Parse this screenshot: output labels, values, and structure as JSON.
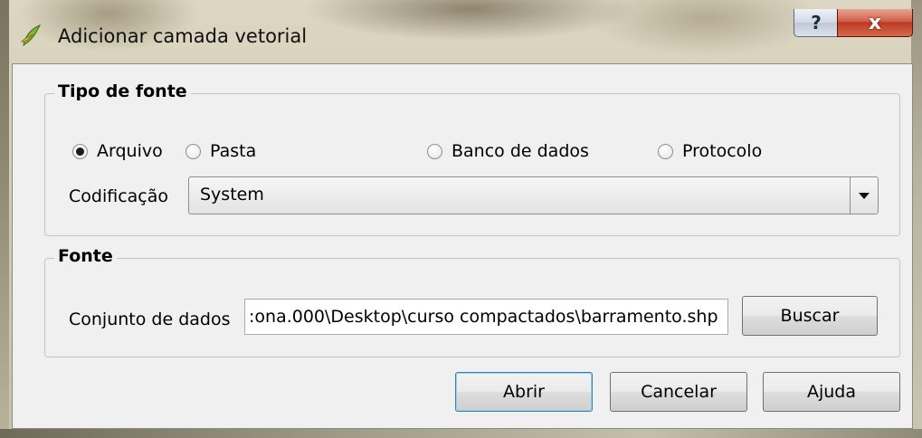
{
  "window": {
    "title": "Adicionar camada vetorial",
    "icon": "qgis-icon",
    "help_label": "?",
    "close_label": "x"
  },
  "source_type": {
    "group_title": "Tipo de fonte",
    "options": [
      "Arquivo",
      "Pasta",
      "Banco de dados",
      "Protocolo"
    ],
    "selected": "Arquivo",
    "encoding_label": "Codificação",
    "encoding_value": "System"
  },
  "source": {
    "group_title": "Fonte",
    "dataset_label": "Conjunto de dados",
    "dataset_value": ":ona.000\\Desktop\\curso compactados\\barramento.shp",
    "browse_label": "Buscar"
  },
  "buttons": {
    "open": "Abrir",
    "cancel": "Cancelar",
    "help": "Ajuda"
  }
}
